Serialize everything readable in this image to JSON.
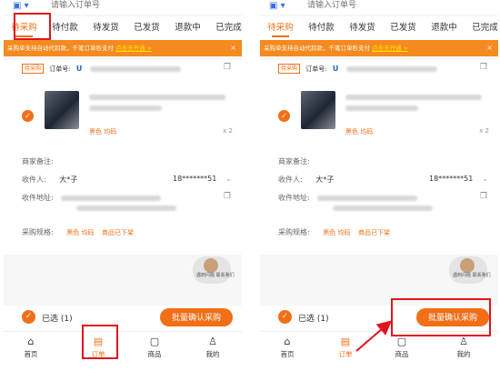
{
  "search": {
    "placeholder": "请输入订单号"
  },
  "tabs": [
    {
      "label": "待采购"
    },
    {
      "label": "待付款"
    },
    {
      "label": "待发货"
    },
    {
      "label": "已发货"
    },
    {
      "label": "退款中"
    },
    {
      "label": "已完成"
    }
  ],
  "banner": {
    "text": "采购单支持自动代扣款，千笔订单秒支付",
    "link": "点击去开通 >",
    "close": "×"
  },
  "order": {
    "tag": "待采购",
    "number_label": "订单号:",
    "logo": "U",
    "spec": "黑色 均码",
    "qty": "x 2",
    "remark_label": "商家备注:",
    "recipient_label": "收件人:",
    "recipient_name": "大*子",
    "phone": "18*******51",
    "address_label": "收件地址:",
    "purchase_spec_label": "采购规格:",
    "purchase_spec": "黑色 均码",
    "status": "商品已下架"
  },
  "customer_service": {
    "label": "遇到问题 联系我们"
  },
  "bottom": {
    "selected": "已选 (1)",
    "confirm": "批量确认采购"
  },
  "nav": [
    {
      "label": "首页",
      "icon": "home-icon",
      "glyph": "⌂"
    },
    {
      "label": "订单",
      "icon": "order-icon",
      "glyph": "▤"
    },
    {
      "label": "商品",
      "icon": "goods-icon",
      "glyph": "▢"
    },
    {
      "label": "我的",
      "icon": "profile-icon",
      "glyph": "♙"
    }
  ],
  "colors": {
    "accent": "#f26f17",
    "banner": "#f58a1f",
    "annotation": "#e0141e"
  }
}
